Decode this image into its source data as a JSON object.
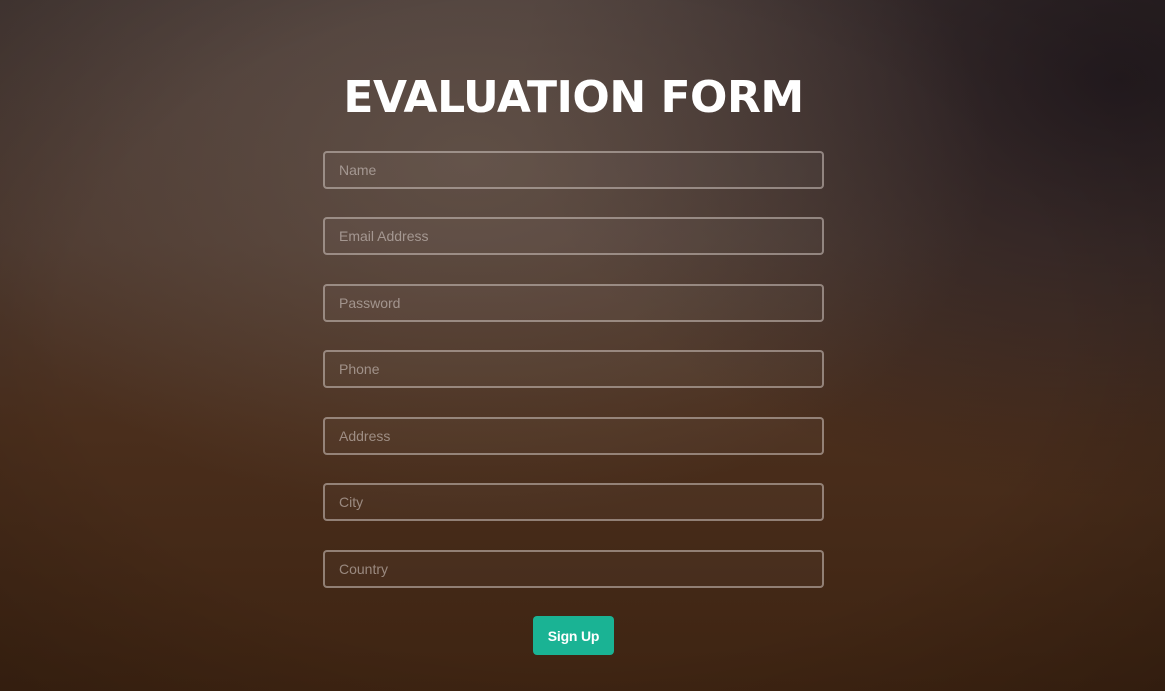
{
  "form": {
    "title": "EVALUATION FORM",
    "fields": [
      {
        "placeholder": "Name",
        "value": ""
      },
      {
        "placeholder": "Email Address",
        "value": ""
      },
      {
        "placeholder": "Password",
        "value": ""
      },
      {
        "placeholder": "Phone",
        "value": ""
      },
      {
        "placeholder": "Address",
        "value": ""
      },
      {
        "placeholder": "City",
        "value": ""
      },
      {
        "placeholder": "Country",
        "value": ""
      }
    ],
    "submit_label": "Sign Up"
  },
  "colors": {
    "button": "#1ab394",
    "title": "#ffffff",
    "field_border": "#cdc3be"
  }
}
